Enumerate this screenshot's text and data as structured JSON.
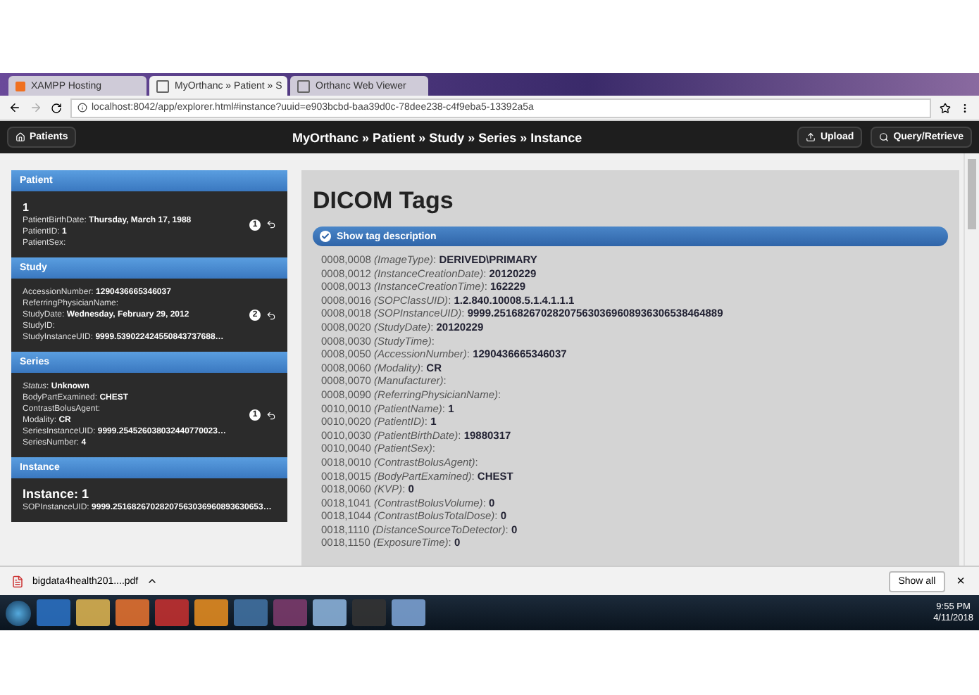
{
  "browser": {
    "tabs": [
      {
        "label": "XAMPP Hosting",
        "selected": false,
        "kind": "xampp"
      },
      {
        "label": "MyOrthanc » Patient » S",
        "selected": true,
        "kind": "page"
      },
      {
        "label": "Orthanc Web Viewer",
        "selected": false,
        "kind": "page"
      }
    ],
    "address": "localhost:8042/app/explorer.html#instance?uuid=e903bcbd-baa39d0c-78dee238-c4f9eba5-13392a5a"
  },
  "header": {
    "back_button": "Patients",
    "title": "MyOrthanc » Patient » Study » Series » Instance",
    "buttons": [
      {
        "label": "Upload",
        "kind": "upload"
      },
      {
        "label": "Query/Retrieve",
        "kind": "search"
      }
    ]
  },
  "sidebar": [
    {
      "title": "Patient",
      "heading": "1",
      "lines": [
        "PatientBirthDate: **Thursday, March 17, 1988**",
        "PatientID: **1**",
        "PatientSex:"
      ],
      "badge": "1"
    },
    {
      "title": "Study",
      "lines": [
        "AccessionNumber: **1290436665346037**",
        "ReferringPhysicianName:",
        "StudyDate: **Wednesday, February 29, 2012**",
        "StudyID:",
        "StudyInstanceUID: **9999.539022424550843737688…**"
      ],
      "badge": "2"
    },
    {
      "title": "Series",
      "lines": [
        "*Status*: **Unknown**",
        "BodyPartExamined: **CHEST**",
        "ContrastBolusAgent:",
        "Modality: **CR**",
        "SeriesInstanceUID: **9999.254526038032440770023…**",
        "SeriesNumber: **4**"
      ],
      "badge": "1"
    },
    {
      "title": "Instance",
      "heading": "Instance: 1",
      "lines": [
        "SOPInstanceUID: **9999.25168267028207563036960893630653…**"
      ]
    }
  ],
  "main": {
    "title": "DICOM Tags",
    "toggle": {
      "label": "Show tag description",
      "checked": true
    },
    "tags": [
      "0008,0008 *(ImageType)*: **DERIVED\\PRIMARY**",
      "0008,0012 *(InstanceCreationDate)*: **20120229**",
      "0008,0013 *(InstanceCreationTime)*: **162229**",
      "0008,0016 *(SOPClassUID)*: **1.2.840.10008.5.1.4.1.1.1**",
      "0008,0018 *(SOPInstanceUID)*: **9999.251682670282075630369608936306538464889**",
      "0008,0020 *(StudyDate)*: **20120229**",
      "0008,0030 *(StudyTime)*:",
      "0008,0050 *(AccessionNumber)*: **1290436665346037**",
      "0008,0060 *(Modality)*: **CR**",
      "0008,0070 *(Manufacturer)*:",
      "0008,0090 *(ReferringPhysicianName)*:",
      "0010,0010 *(PatientName)*: **1**",
      "0010,0020 *(PatientID)*: **1**",
      "0010,0030 *(PatientBirthDate)*: **19880317**",
      "0010,0040 *(PatientSex)*:",
      "0018,0010 *(ContrastBolusAgent)*:",
      "0018,0015 *(BodyPartExamined)*: **CHEST**",
      "0018,0060 *(KVP)*: **0**",
      "0018,1041 *(ContrastBolusVolume)*: **0**",
      "0018,1044 *(ContrastBolusTotalDose)*: **0**",
      "0018,1110 *(DistanceSourceToDetector)*: **0**",
      "0018,1150 *(ExposureTime)*: **0**"
    ]
  },
  "downloads": {
    "file": "bigdata4health201....pdf",
    "show_all": "Show all",
    "close": "×"
  },
  "taskbar": {
    "apps": [
      {
        "kind": "ie"
      },
      {
        "kind": "folder"
      },
      {
        "kind": "media"
      },
      {
        "kind": "shield"
      },
      {
        "kind": "sublime"
      },
      {
        "kind": "python"
      },
      {
        "kind": "archive"
      },
      {
        "kind": "chrome"
      },
      {
        "kind": "terminal"
      },
      {
        "kind": "viewer"
      }
    ],
    "time": "9:55 PM",
    "date": "4/11/2018"
  }
}
